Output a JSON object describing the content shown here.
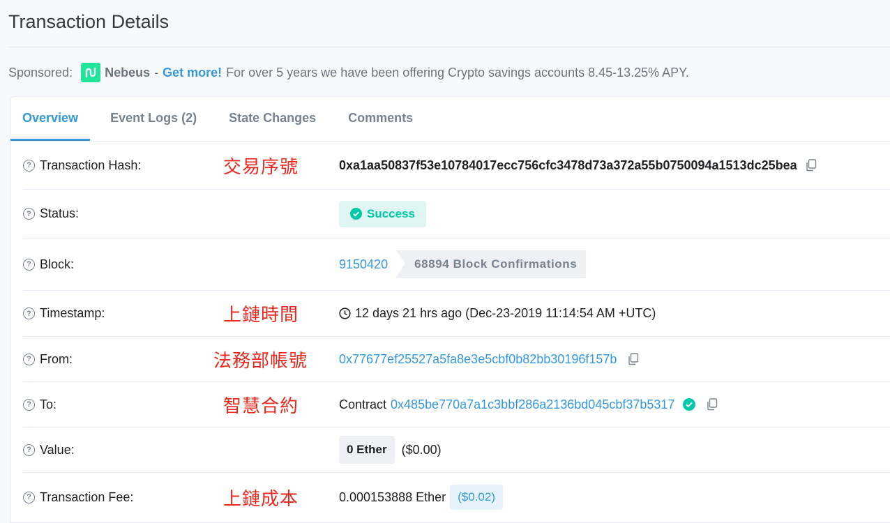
{
  "page": {
    "title": "Transaction Details"
  },
  "sponsored": {
    "label": "Sponsored:",
    "brand": "Nebeus",
    "dash": "-",
    "cta": "Get more!",
    "text": "For over 5 years we have been offering Crypto savings accounts 8.45-13.25% APY."
  },
  "tabs": [
    {
      "label": "Overview",
      "active": true
    },
    {
      "label": "Event Logs (2)",
      "active": false
    },
    {
      "label": "State Changes",
      "active": false
    },
    {
      "label": "Comments",
      "active": false
    }
  ],
  "details": {
    "hash": {
      "label": "Transaction Hash:",
      "annotation": "交易序號",
      "value": "0xa1aa50837f53e10784017ecc756cfc3478d73a372a55b0750094a1513dc25bea"
    },
    "status": {
      "label": "Status:",
      "value": "Success"
    },
    "block": {
      "label": "Block:",
      "number": "9150420",
      "confirmations": "68894 Block Confirmations"
    },
    "timestamp": {
      "label": "Timestamp:",
      "annotation": "上鏈時間",
      "value": "12 days 21 hrs ago (Dec-23-2019 11:14:54 AM +UTC)"
    },
    "from": {
      "label": "From:",
      "annotation": "法務部帳號",
      "value": "0x77677ef25527a5fa8e3e5cbf0b82bb30196f157b"
    },
    "to": {
      "label": "To:",
      "annotation": "智慧合約",
      "prefix": "Contract",
      "value": "0x485be770a7a1c3bbf286a2136bd045cbf37b5317"
    },
    "value": {
      "label": "Value:",
      "ether": "0 Ether",
      "usd": "($0.00)"
    },
    "fee": {
      "label": "Transaction Fee:",
      "annotation": "上鏈成本",
      "ether": "0.000153888 Ether",
      "usd": "($0.02)"
    }
  },
  "colors": {
    "accent": "#3498db",
    "success": "#00c9a7",
    "annotation": "#e8281e",
    "brand": "#1ee59a"
  }
}
